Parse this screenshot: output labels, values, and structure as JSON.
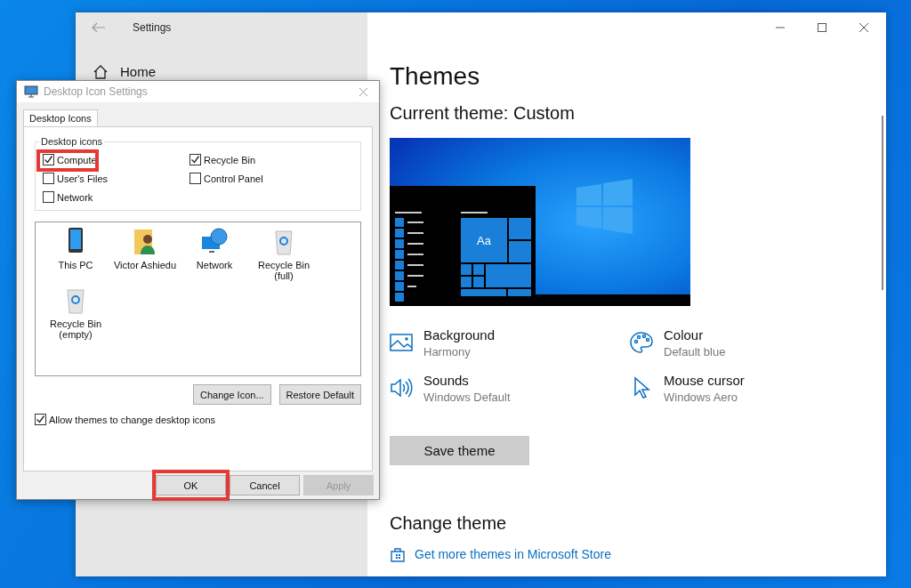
{
  "settings_window": {
    "title": "Settings",
    "nav": [
      {
        "label": "Home"
      }
    ],
    "page_title": "Themes",
    "current_theme": "Current theme: Custom",
    "preview": {
      "tile_text": "Aa"
    },
    "properties": [
      {
        "kind": "background",
        "label": "Background",
        "value": "Harmony"
      },
      {
        "kind": "colour",
        "label": "Colour",
        "value": "Default blue"
      },
      {
        "kind": "sounds",
        "label": "Sounds",
        "value": "Windows Default"
      },
      {
        "kind": "cursor",
        "label": "Mouse cursor",
        "value": "Windows Aero"
      }
    ],
    "save_button": "Save theme",
    "change_theme": "Change theme",
    "store_link": "Get more themes in Microsoft Store"
  },
  "dialog": {
    "title": "Desktop Icon Settings",
    "tabs": [
      {
        "label": "Desktop Icons",
        "selected": true
      }
    ],
    "group_label": "Desktop icons",
    "checkboxes": [
      {
        "label": "Compute",
        "checked": true,
        "highlighted": true
      },
      {
        "label": "Recycle Bin",
        "checked": true,
        "highlighted": false
      },
      {
        "label": "User's Files",
        "checked": false,
        "highlighted": false
      },
      {
        "label": "Control Panel",
        "checked": false,
        "highlighted": false
      },
      {
        "label": "Network",
        "checked": false,
        "highlighted": false
      }
    ],
    "icons": [
      {
        "kind": "pc",
        "label": "This PC"
      },
      {
        "kind": "user",
        "label": "Victor Ashiedu"
      },
      {
        "kind": "network",
        "label": "Network"
      },
      {
        "kind": "bin",
        "label": "Recycle Bin (full)"
      },
      {
        "kind": "bin",
        "label": "Recycle Bin (empty)"
      }
    ],
    "change_icon": "Change Icon...",
    "restore_default": "Restore Default",
    "allow_themes": {
      "label": "Allow themes to change desktop icons",
      "checked": true
    },
    "buttons": [
      {
        "label": "OK",
        "disabled": false,
        "highlighted": true
      },
      {
        "label": "Cancel",
        "disabled": false,
        "highlighted": false
      },
      {
        "label": "Apply",
        "disabled": true,
        "highlighted": false
      }
    ]
  }
}
